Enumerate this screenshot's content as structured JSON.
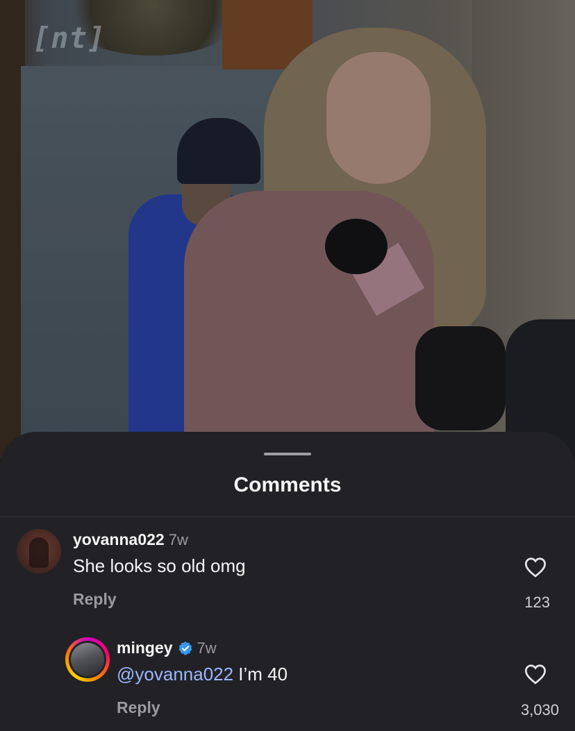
{
  "video": {
    "watermark": "[nt]"
  },
  "sheet": {
    "title": "Comments"
  },
  "comments": [
    {
      "username": "yovanna022",
      "time": "7w",
      "text": "She looks so old omg",
      "reply_label": "Reply",
      "likes": "123",
      "verified": false
    },
    {
      "username": "mingey",
      "time": "7w",
      "mention": "@yovanna022",
      "text": " I’m 40",
      "reply_label": "Reply",
      "likes": "3,030",
      "verified": true,
      "has_story_ring": true
    }
  ],
  "colors": {
    "sheet_bg": "#222226",
    "mention": "#9db7ff",
    "verified": "#3897f0",
    "secondary_text": "#9a9aa0"
  }
}
